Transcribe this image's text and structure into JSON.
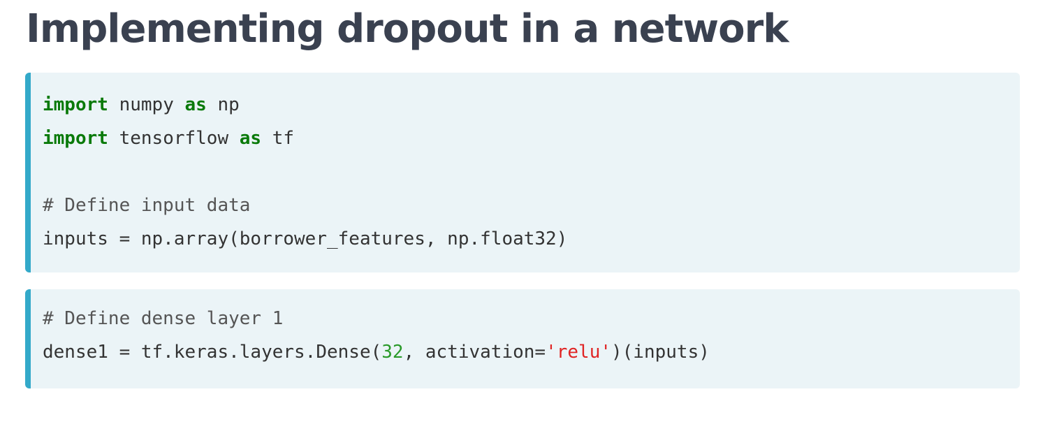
{
  "page": {
    "title": "Implementing dropout in a network"
  },
  "colors": {
    "title": "#3a4150",
    "code_background": "#ebf4f7",
    "code_accent_border": "#33a9c9",
    "keyword": "#0a7a0a",
    "comment": "#555555",
    "number": "#2a9a2a",
    "string": "#e02424"
  },
  "code_blocks": [
    {
      "lines": [
        {
          "kw1": "import",
          "t1": " numpy ",
          "kw2": "as",
          "t2": " np"
        },
        {
          "kw1": "import",
          "t1": " tensorflow ",
          "kw2": "as",
          "t2": " tf"
        },
        {
          "blank": ""
        },
        {
          "comment": "# Define input data"
        },
        {
          "text": "inputs = np.array(borrower_features, np.float32)"
        }
      ]
    },
    {
      "lines": [
        {
          "comment": "# Define dense layer 1"
        },
        {
          "pre": "dense1 = tf.keras.layers.Dense(",
          "num": "32",
          "mid": ", activation=",
          "str": "'relu'",
          "post": ")(inputs)"
        }
      ]
    }
  ]
}
